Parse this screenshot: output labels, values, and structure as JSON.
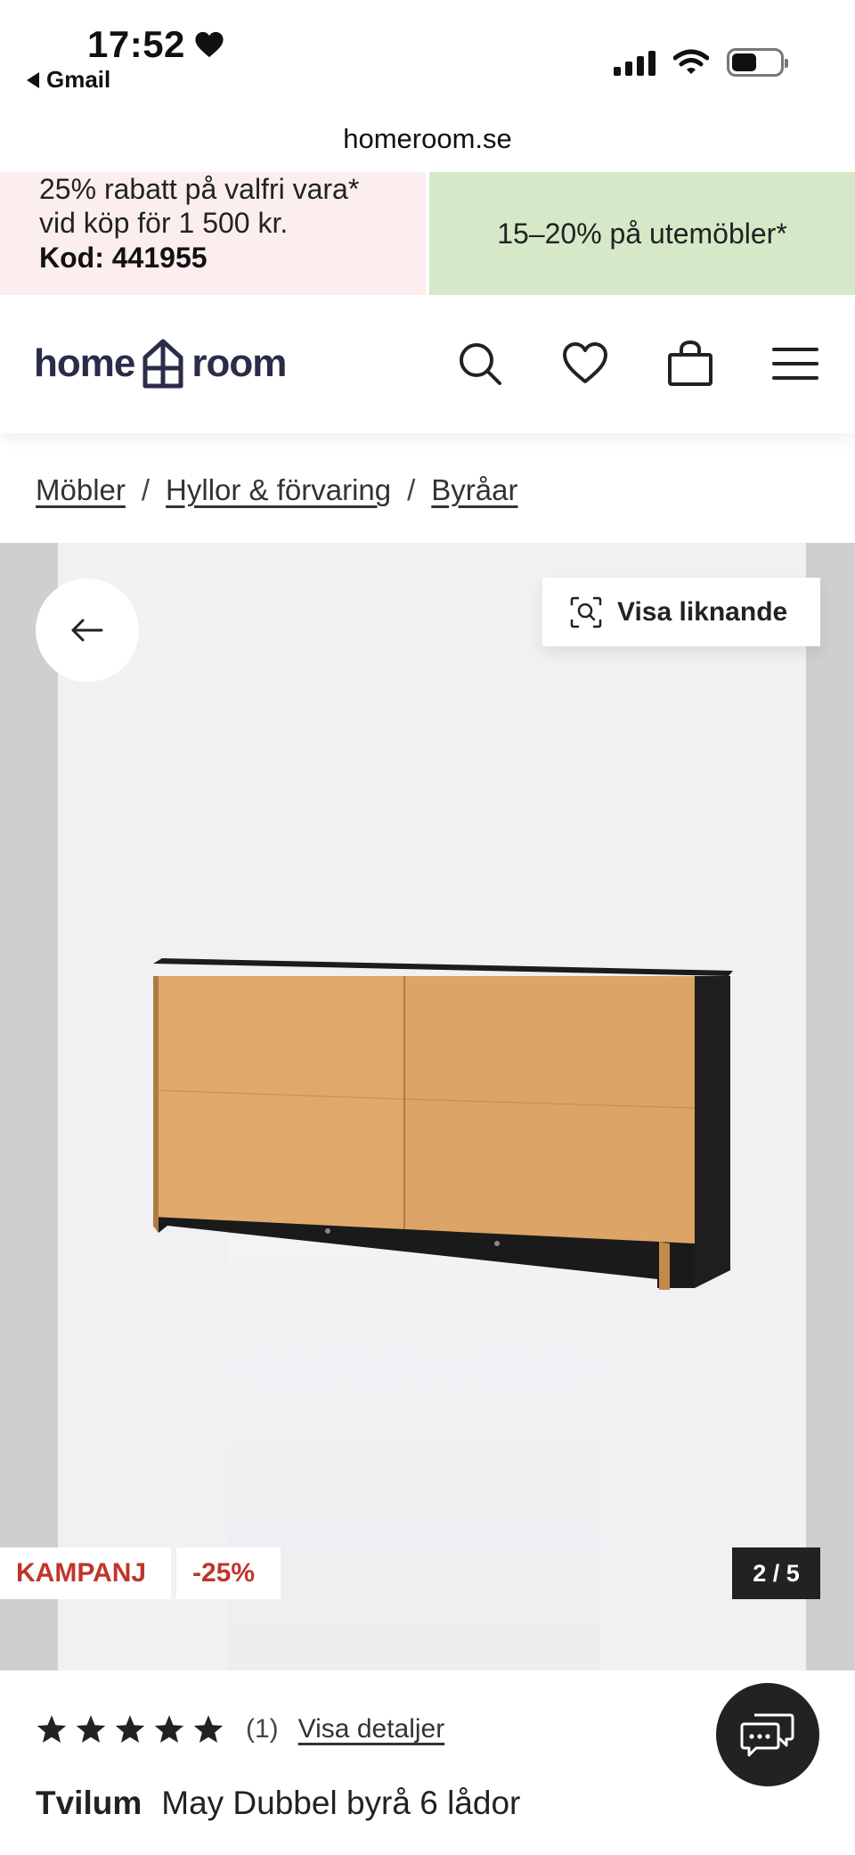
{
  "status_bar": {
    "time": "17:52",
    "back_app": "Gmail"
  },
  "browser": {
    "url": "homeroom.se"
  },
  "promos": {
    "left_line1": "25% rabatt på valfri vara*",
    "left_line2": "vid köp för 1 500 kr.",
    "left_code": "Kod: 441955",
    "right_text": "15–20% på utemöbler*"
  },
  "header": {
    "logo_left": "home",
    "logo_right": "room",
    "icons": [
      "search-icon",
      "heart-icon",
      "bag-icon",
      "menu-icon"
    ]
  },
  "breadcrumb": {
    "items": [
      "Möbler",
      "Hyllor & förvaring",
      "Byråar"
    ],
    "separator": "/"
  },
  "gallery": {
    "similar_label": "Visa liknande",
    "badge_campaign": "KAMPANJ",
    "badge_discount": "-25%",
    "counter": "2 / 5",
    "current_index": 2,
    "total": 5
  },
  "product": {
    "rating": 5,
    "rating_count": "(1)",
    "details_link": "Visa detaljer",
    "brand": "Tvilum",
    "name": "May Dubbel byrå 6 lådor"
  },
  "colors": {
    "accent_red": "#c0352b",
    "promo_pink": "#fceeee",
    "promo_green": "#d5e8c8",
    "logo_navy": "#2a2d4a",
    "dark": "#222222"
  }
}
